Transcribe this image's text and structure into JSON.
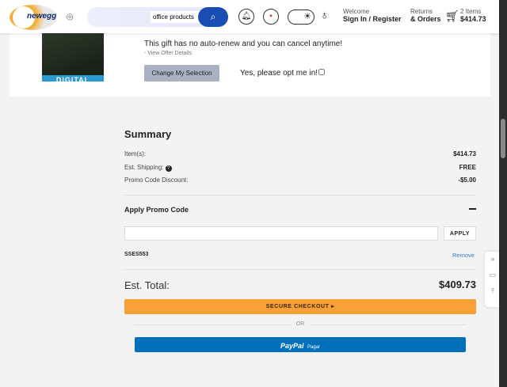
{
  "header": {
    "logo": "newegg",
    "search_value": "office products",
    "welcome": "Welcome",
    "sign_in": "Sign In / Register",
    "returns": "Returns",
    "orders": "& Orders",
    "cart_count": "2 Items",
    "cart_total": "$414.73"
  },
  "offer": {
    "image_label": "DIGITAL",
    "text": "This gift has no auto-renew and you can cancel anytime!",
    "details_link": "- View Offer Details",
    "change_button": "Change My Selection",
    "opt_in": "Yes, please opt me in!",
    "opt_in_checked": false
  },
  "summary": {
    "title": "Summary",
    "rows": [
      {
        "label": "Item(s):",
        "value": "$414.73"
      },
      {
        "label": "Est. Shipping:",
        "value": "FREE"
      },
      {
        "label": "Promo Code Discount:",
        "value": "-$5.00"
      }
    ],
    "promo_title": "Apply Promo Code",
    "promo_input": "",
    "apply_button": "APPLY",
    "applied_code": "SSES553",
    "remove_link": "Remove",
    "total_label": "Est. Total:",
    "total_value": "$409.73",
    "checkout_button": "SECURE CHECKOUT ▸",
    "or": "OR",
    "paypal_button": "PayPal",
    "paypal_sub": "Pagar"
  },
  "colors": {
    "accent": "#1a4db3",
    "checkout": "#f7a035",
    "paypal": "#0070ba",
    "link": "#2f7bd1"
  }
}
